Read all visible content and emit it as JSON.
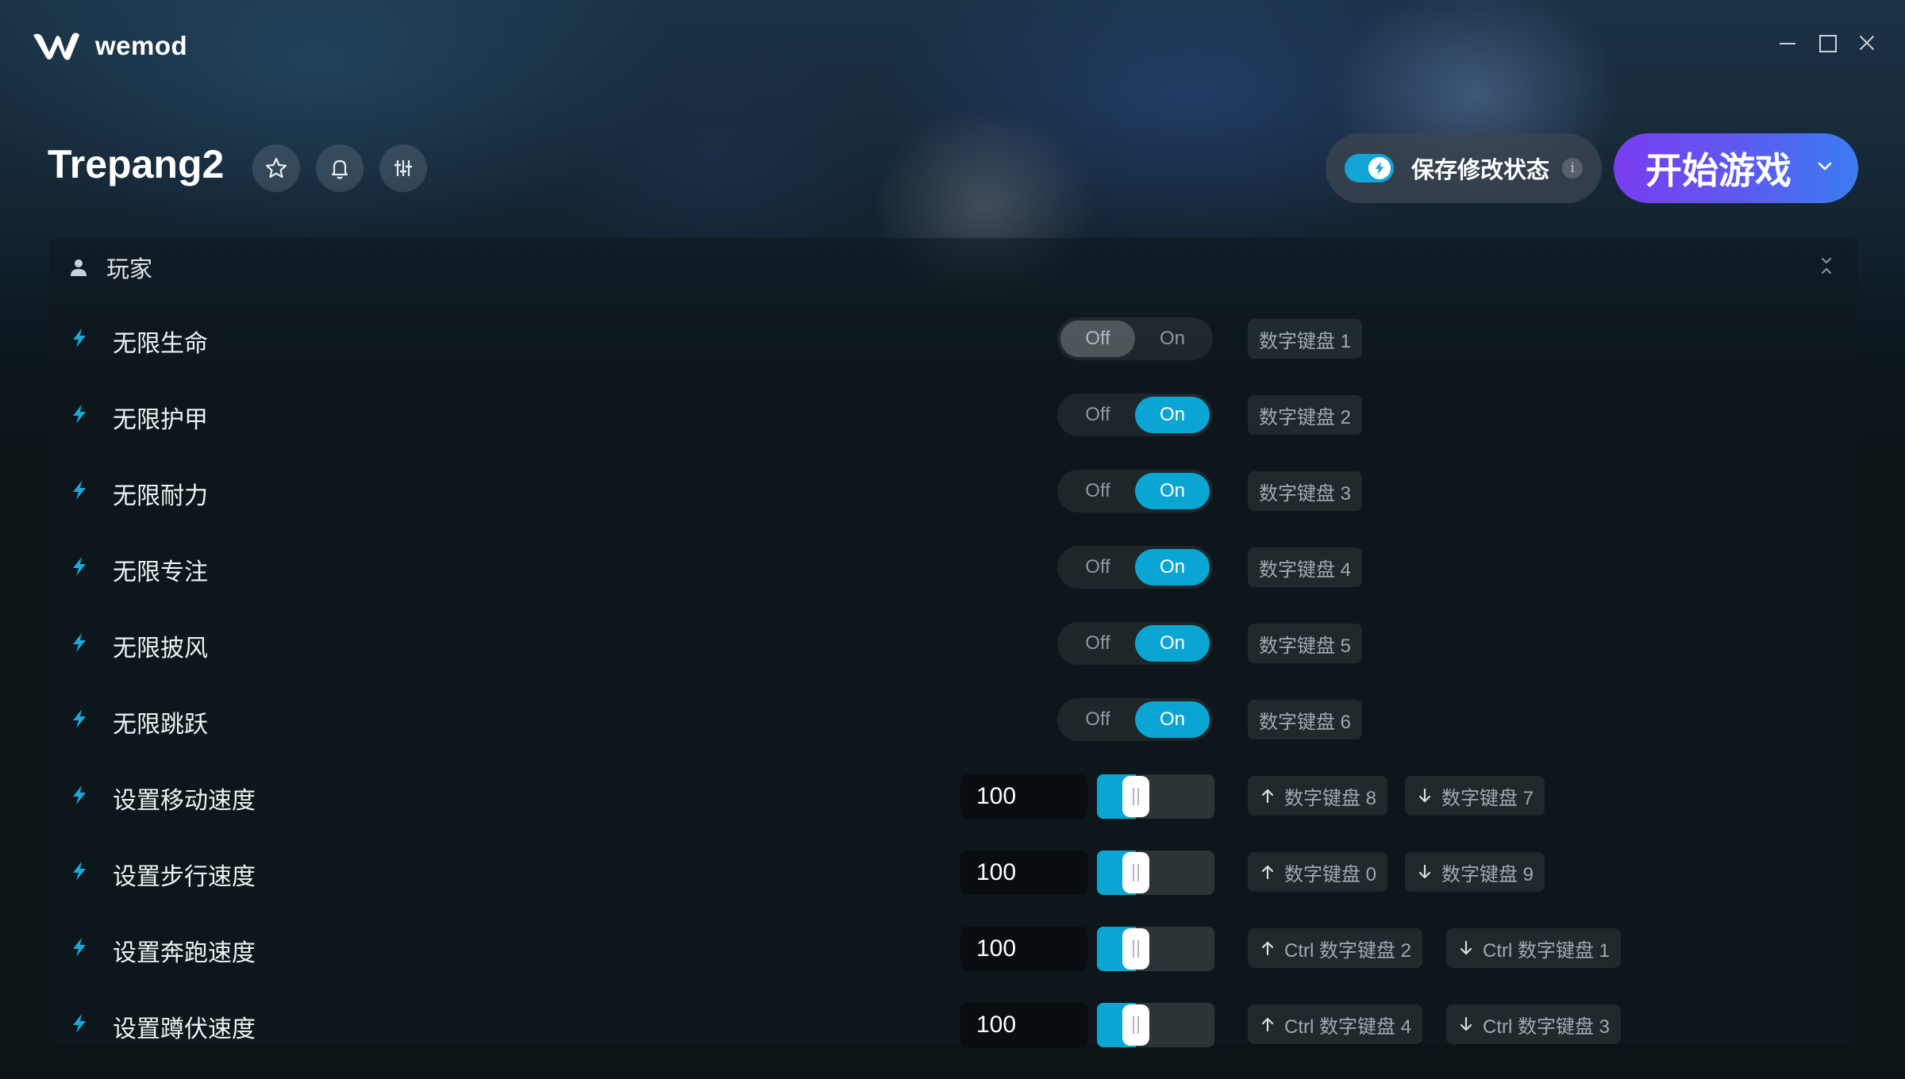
{
  "app": {
    "name": "wemod"
  },
  "game": {
    "title": "Trepang2"
  },
  "header": {
    "save_mods_label": "保存修改状态",
    "info_glyph": "i",
    "play_label": "开始游戏"
  },
  "category": {
    "label": "玩家"
  },
  "toggle_labels": {
    "off": "Off",
    "on": "On"
  },
  "toggles": [
    {
      "label": "无限生命",
      "state": "off",
      "hotkey": "数字键盘 1"
    },
    {
      "label": "无限护甲",
      "state": "on",
      "hotkey": "数字键盘 2"
    },
    {
      "label": "无限耐力",
      "state": "on",
      "hotkey": "数字键盘 3"
    },
    {
      "label": "无限专注",
      "state": "on",
      "hotkey": "数字键盘 4"
    },
    {
      "label": "无限披风",
      "state": "on",
      "hotkey": "数字键盘 5"
    },
    {
      "label": "无限跳跃",
      "state": "on",
      "hotkey": "数字键盘 6"
    }
  ],
  "sliders": [
    {
      "label": "设置移动速度",
      "value": "100",
      "fraction": 0.33,
      "hotkey_up": "数字键盘 8",
      "hotkey_down": "数字键盘 7"
    },
    {
      "label": "设置步行速度",
      "value": "100",
      "fraction": 0.33,
      "hotkey_up": "数字键盘 0",
      "hotkey_down": "数字键盘 9"
    },
    {
      "label": "设置奔跑速度",
      "value": "100",
      "fraction": 0.33,
      "hotkey_up": "Ctrl 数字键盘 2",
      "hotkey_down": "Ctrl 数字键盘 1"
    },
    {
      "label": "设置蹲伏速度",
      "value": "100",
      "fraction": 0.33,
      "hotkey_up": "Ctrl 数字键盘 4",
      "hotkey_down": "Ctrl 数字键盘 3"
    }
  ],
  "colors": {
    "accent": "#0aa5d2",
    "play_gradient_start": "#7b3cf0",
    "play_gradient_end": "#3b7cf0",
    "background": "#0c1418"
  },
  "icons": {
    "bolt": "lightning-bolt-icon",
    "category": "person-icon",
    "favorite": "star-icon",
    "notify": "bell-icon",
    "settings": "sliders-icon"
  }
}
